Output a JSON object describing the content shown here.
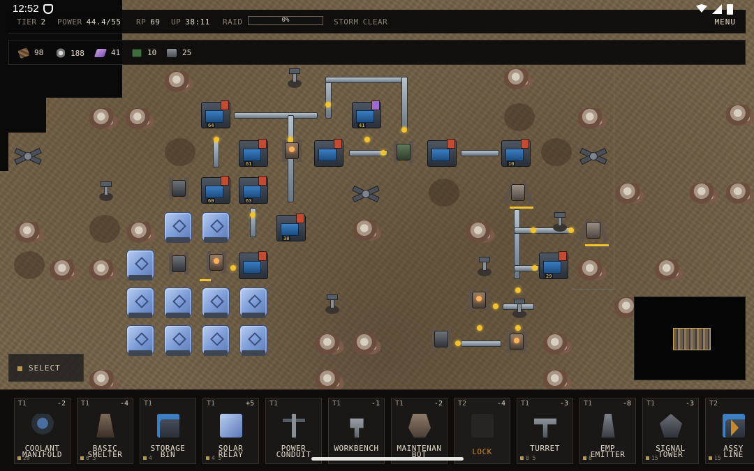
{
  "status_bar": {
    "time": "12:52"
  },
  "hud": {
    "tier_label": "TIER",
    "tier_value": "2",
    "power_label": "POWER",
    "power_value": "44.4/55",
    "rp_label": "RP",
    "rp_value": "69",
    "up_label": "UP",
    "up_value": "38:11",
    "raid_label": "RAID",
    "raid_percent": "0%",
    "raid_fraction": 0,
    "storm_label": "STORM",
    "storm_value": "CLEAR",
    "menu_label": "MENU"
  },
  "resources": [
    {
      "icon": "scrap-icon",
      "value": "98"
    },
    {
      "icon": "metal-icon",
      "value": "188"
    },
    {
      "icon": "crystal-icon",
      "value": "41"
    },
    {
      "icon": "circuit-icon",
      "value": "10"
    },
    {
      "icon": "ingot-icon",
      "value": "25"
    }
  ],
  "select_label": "SELECT",
  "map_labels": [
    "64",
    "41",
    "61",
    "10",
    "60",
    "63",
    "38",
    "29"
  ],
  "build_cards": [
    {
      "tier": "T1",
      "delta": "-2",
      "name": "COOLANT\nMANIFOLD",
      "cost": "20",
      "thumb": "coolant",
      "locked": false
    },
    {
      "tier": "T1",
      "delta": "-4",
      "name": "BASIC\nSMELTER",
      "cost": "6  3",
      "thumb": "smelter",
      "locked": false
    },
    {
      "tier": "T1",
      "delta": "",
      "name": "STORAGE\nBIN",
      "cost": "4",
      "thumb": "storage",
      "locked": false
    },
    {
      "tier": "T1",
      "delta": "+5",
      "name": "SOLAR\nRELAY",
      "cost": "4  5",
      "thumb": "solar",
      "locked": false
    },
    {
      "tier": "T1",
      "delta": "",
      "name": "POWER\nCONDUIT",
      "cost": "",
      "thumb": "power",
      "locked": false
    },
    {
      "tier": "T1",
      "delta": "-1",
      "name": "WORKBENCH",
      "cost": "",
      "thumb": "workbench",
      "locked": false
    },
    {
      "tier": "T1",
      "delta": "-2",
      "name": "MAINTENAN\nBOT",
      "cost": "",
      "thumb": "bot",
      "locked": false
    },
    {
      "tier": "T2",
      "delta": "-4",
      "name": "LOCK",
      "cost": "",
      "thumb": "lock",
      "locked": true
    },
    {
      "tier": "T1",
      "delta": "-3",
      "name": "TURRET",
      "cost": "8  5",
      "thumb": "turret",
      "locked": false
    },
    {
      "tier": "T1",
      "delta": "-8",
      "name": "EMP\nEMITTER",
      "cost": "8",
      "thumb": "emp",
      "locked": false
    },
    {
      "tier": "T1",
      "delta": "-3",
      "name": "SIGNAL\nTOWER",
      "cost": "15",
      "thumb": "signal",
      "locked": false
    },
    {
      "tier": "T2",
      "delta": "",
      "name": "ASSY\nLINE",
      "cost": "15",
      "thumb": "storage",
      "locked": false
    }
  ],
  "colors": {
    "accent": "#c7892d",
    "power_node": "#f2c230",
    "solar": "#8fa9e0",
    "machine_blue": "#3b7fc2"
  }
}
